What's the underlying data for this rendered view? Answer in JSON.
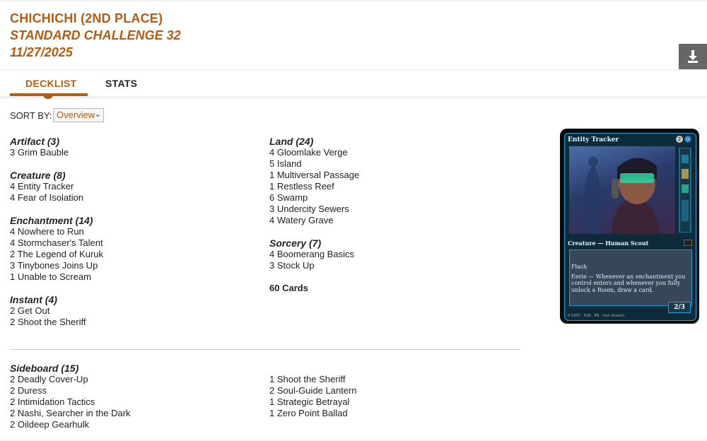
{
  "header": {
    "player": "CHICHICHI (2ND PLACE)",
    "event": "STANDARD CHALLENGE 32",
    "date": "11/27/2025",
    "download_icon": "download-icon"
  },
  "tabs": [
    {
      "label": "DECKLIST",
      "active": true
    },
    {
      "label": "STATS",
      "active": false
    }
  ],
  "sort": {
    "label": "SORT BY:",
    "selected": "Overview"
  },
  "maindeck": {
    "left": [
      {
        "title": "Artifact (3)",
        "cards": [
          "3 Grim Bauble"
        ]
      },
      {
        "title": "Creature (8)",
        "cards": [
          "4 Entity Tracker",
          "4 Fear of Isolation"
        ]
      },
      {
        "title": "Enchantment (14)",
        "cards": [
          "4 Nowhere to Run",
          "4 Stormchaser's Talent",
          "2 The Legend of Kuruk",
          "3 Tinybones Joins Up",
          "1 Unable to Scream"
        ]
      },
      {
        "title": "Instant (4)",
        "cards": [
          "2 Get Out",
          "2 Shoot the Sheriff"
        ]
      }
    ],
    "right": [
      {
        "title": "Land (24)",
        "cards": [
          "4 Gloomlake Verge",
          "5 Island",
          "1 Multiversal Passage",
          "1 Restless Reef",
          "6 Swamp",
          "3 Undercity Sewers",
          "4 Watery Grave"
        ]
      },
      {
        "title": "Sorcery (7)",
        "cards": [
          "4 Boomerang Basics",
          "3 Stock Up"
        ]
      }
    ],
    "total": "60 Cards"
  },
  "sideboard": {
    "title": "Sideboard (15)",
    "left": [
      "2 Deadly Cover-Up",
      "2 Duress",
      "2 Intimidation Tactics",
      "2 Nashi, Searcher in the Dark",
      "2 Oildeep Gearhulk"
    ],
    "right": [
      "1 Shoot the Sheriff",
      "2 Soul-Guide Lantern",
      "1 Strategic Betrayal",
      "1 Zero Point Ballad"
    ]
  },
  "card_preview": {
    "name": "Entity Tracker",
    "mana": [
      "2",
      "U"
    ],
    "type_line": "Creature — Human Scout",
    "keyword": "Flash",
    "ability": "Eerie — Whenever an enchantment you control enters and whenever you fully unlock a Room, draw a card.",
    "pt": "2/3",
    "collector": "R 0307 · DSK · EN · Ivan Shavrin",
    "colors": {
      "frame": "#0d2b3a",
      "accent": "#2aa6d6"
    }
  },
  "colors": {
    "accent": "#b35c12",
    "download_bg": "#666666"
  }
}
